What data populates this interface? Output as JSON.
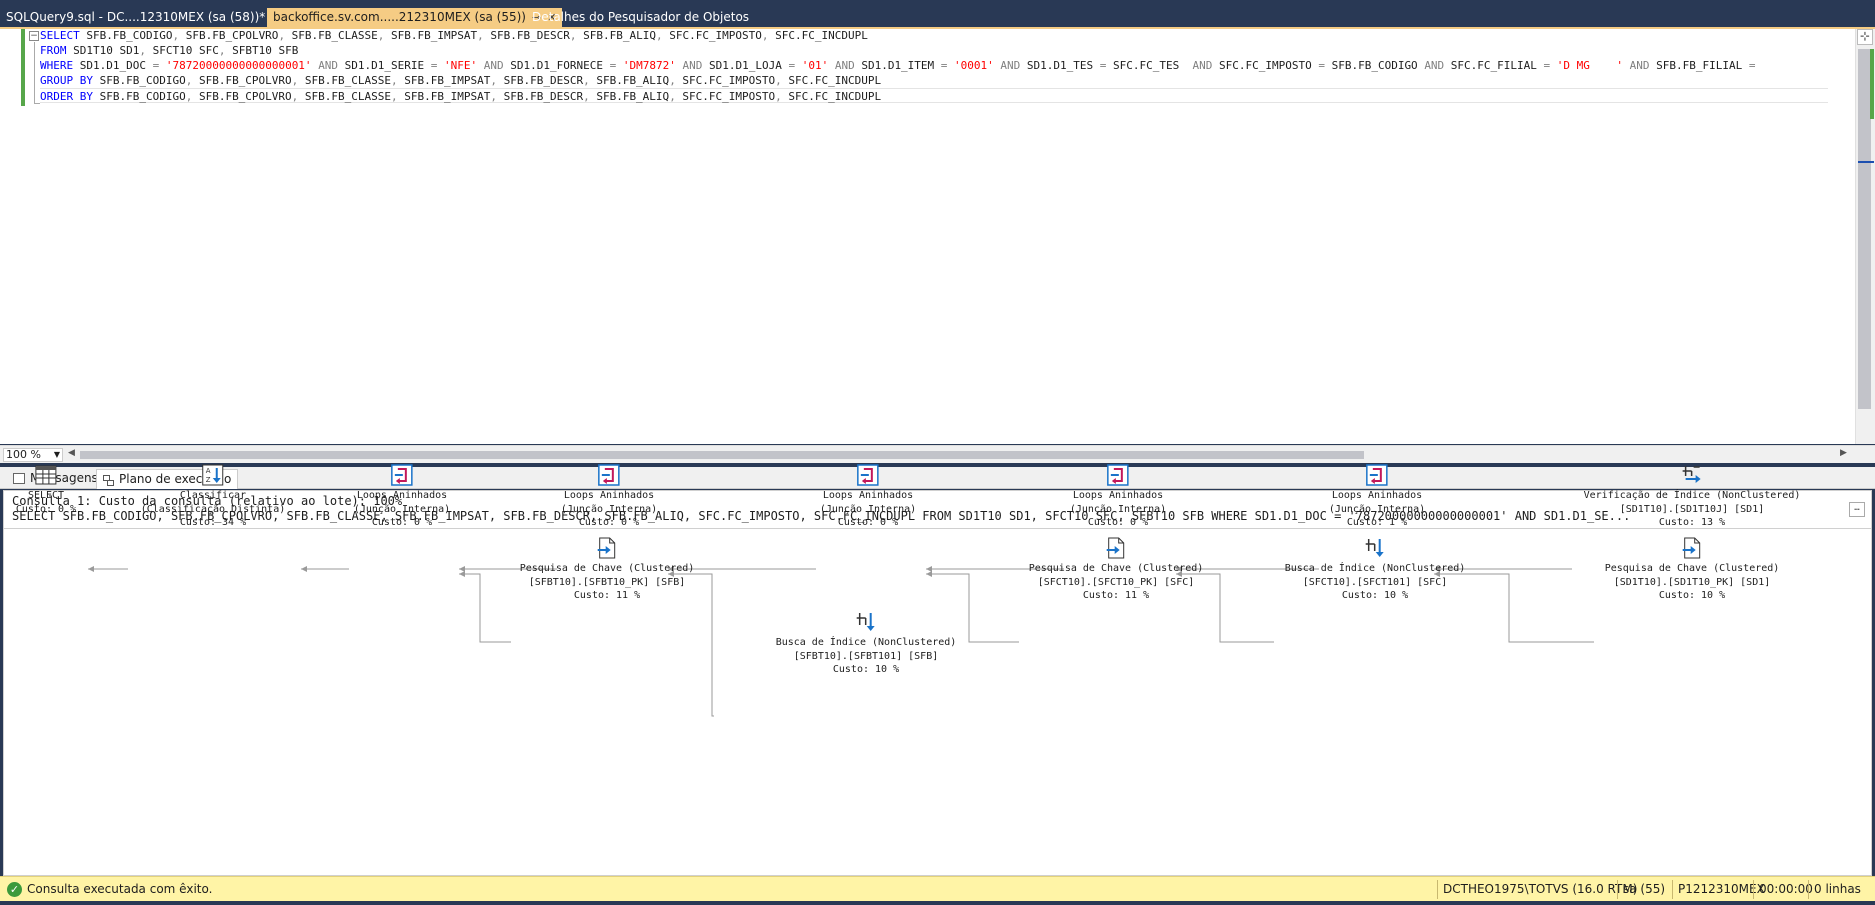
{
  "tabs": [
    {
      "label": "SQLQuery9.sql - DC....12310MEX (sa (58))*",
      "active": false
    },
    {
      "label": "backoffice.sv.com.....212310MEX (sa (55))",
      "active": true,
      "pin_icon": "pin-icon",
      "close_icon": "close-icon"
    },
    {
      "label": "Detalhes do Pesquisador de Objetos",
      "active": false
    }
  ],
  "editor": {
    "zoom": "100 %",
    "lines": [
      [
        [
          "kw",
          "SELECT"
        ],
        [
          "t",
          " SFB.FB_CODIGO"
        ],
        [
          "op",
          ","
        ],
        [
          "t",
          " SFB.FB_CPOLVRO"
        ],
        [
          "op",
          ","
        ],
        [
          "t",
          " SFB.FB_CLASSE"
        ],
        [
          "op",
          ","
        ],
        [
          "t",
          " SFB.FB_IMPSAT"
        ],
        [
          "op",
          ","
        ],
        [
          "t",
          " SFB.FB_DESCR"
        ],
        [
          "op",
          ","
        ],
        [
          "t",
          " SFB.FB_ALIQ"
        ],
        [
          "op",
          ","
        ],
        [
          "t",
          " SFC.FC_IMPOSTO"
        ],
        [
          "op",
          ","
        ],
        [
          "t",
          " SFC.FC_INCDUPL"
        ]
      ],
      [
        [
          "kw",
          "FROM"
        ],
        [
          "t",
          " SD1T10 SD1"
        ],
        [
          "op",
          ","
        ],
        [
          "t",
          " SFCT10 SFC"
        ],
        [
          "op",
          ","
        ],
        [
          "t",
          " SFBT10 SFB"
        ]
      ],
      [
        [
          "kw",
          "WHERE"
        ],
        [
          "t",
          " SD1.D1_DOC "
        ],
        [
          "op",
          "="
        ],
        [
          "t",
          " "
        ],
        [
          "str",
          "'78720000000000000001'"
        ],
        [
          "t",
          " "
        ],
        [
          "op",
          "AND"
        ],
        [
          "t",
          " SD1.D1_SERIE "
        ],
        [
          "op",
          "="
        ],
        [
          "t",
          " "
        ],
        [
          "str",
          "'NFE'"
        ],
        [
          "t",
          " "
        ],
        [
          "op",
          "AND"
        ],
        [
          "t",
          " SD1.D1_FORNECE "
        ],
        [
          "op",
          "="
        ],
        [
          "t",
          " "
        ],
        [
          "str",
          "'DM7872'"
        ],
        [
          "t",
          " "
        ],
        [
          "op",
          "AND"
        ],
        [
          "t",
          " SD1.D1_LOJA "
        ],
        [
          "op",
          "="
        ],
        [
          "t",
          " "
        ],
        [
          "str",
          "'01'"
        ],
        [
          "t",
          " "
        ],
        [
          "op",
          "AND"
        ],
        [
          "t",
          " SD1.D1_ITEM "
        ],
        [
          "op",
          "="
        ],
        [
          "t",
          " "
        ],
        [
          "str",
          "'0001'"
        ],
        [
          "t",
          " "
        ],
        [
          "op",
          "AND"
        ],
        [
          "t",
          " SD1.D1_TES "
        ],
        [
          "op",
          "="
        ],
        [
          "t",
          " SFC.FC_TES  "
        ],
        [
          "op",
          "AND"
        ],
        [
          "t",
          " SFC.FC_IMPOSTO "
        ],
        [
          "op",
          "="
        ],
        [
          "t",
          " SFB.FB_CODIGO "
        ],
        [
          "op",
          "AND"
        ],
        [
          "t",
          " SFC.FC_FILIAL "
        ],
        [
          "op",
          "="
        ],
        [
          "t",
          " "
        ],
        [
          "str",
          "'D MG    '"
        ],
        [
          "t",
          " "
        ],
        [
          "op",
          "AND"
        ],
        [
          "t",
          " SFB.FB_FILIAL "
        ],
        [
          "op",
          "="
        ]
      ],
      [
        [
          "kw",
          "GROUP BY"
        ],
        [
          "t",
          " SFB.FB_CODIGO"
        ],
        [
          "op",
          ","
        ],
        [
          "t",
          " SFB.FB_CPOLVRO"
        ],
        [
          "op",
          ","
        ],
        [
          "t",
          " SFB.FB_CLASSE"
        ],
        [
          "op",
          ","
        ],
        [
          "t",
          " SFB.FB_IMPSAT"
        ],
        [
          "op",
          ","
        ],
        [
          "t",
          " SFB.FB_DESCR"
        ],
        [
          "op",
          ","
        ],
        [
          "t",
          " SFB.FB_ALIQ"
        ],
        [
          "op",
          ","
        ],
        [
          "t",
          " SFC.FC_IMPOSTO"
        ],
        [
          "op",
          ","
        ],
        [
          "t",
          " SFC.FC_INCDUPL"
        ]
      ],
      [
        [
          "kw",
          "ORDER BY"
        ],
        [
          "t",
          " SFB.FB_CODIGO"
        ],
        [
          "op",
          ","
        ],
        [
          "t",
          " SFB.FB_CPOLVRO"
        ],
        [
          "op",
          ","
        ],
        [
          "t",
          " SFB.FB_CLASSE"
        ],
        [
          "op",
          ","
        ],
        [
          "t",
          " SFB.FB_IMPSAT"
        ],
        [
          "op",
          ","
        ],
        [
          "t",
          " SFB.FB_DESCR"
        ],
        [
          "op",
          ","
        ],
        [
          "t",
          " SFB.FB_ALIQ"
        ],
        [
          "op",
          ","
        ],
        [
          "t",
          " SFC.FC_IMPOSTO"
        ],
        [
          "op",
          ","
        ],
        [
          "t",
          " SFC.FC_INCDUPL"
        ]
      ]
    ]
  },
  "results": {
    "tabs": [
      {
        "label": "Mensagens",
        "icon": "messages-icon"
      },
      {
        "label": "Plano de execução",
        "icon": "execution-plan-icon"
      }
    ],
    "plan_header": {
      "query_cost": "Consulta 1: Custo da consulta (relativo ao lote): 100%",
      "query_text": "SELECT SFB.FB_CODIGO, SFB.FB_CPOLVRO, SFB.FB_CLASSE, SFB.FB_IMPSAT, SFB.FB_DESCR, SFB.FB_ALIQ, SFC.FC_IMPOSTO, SFC.FC_INCDUPL FROM SD1T10 SD1, SFCT10 SFC, SFBT10 SFB WHERE SD1.D1_DOC = '78720000000000000001' AND SD1.D1_SE..."
    },
    "plan_nodes": [
      {
        "id": "select",
        "icon": "select-icon",
        "lines": [
          "SELECT",
          "Custo: 0 %"
        ]
      },
      {
        "id": "sort",
        "icon": "sort-icon",
        "lines": [
          "Classificar",
          "(Classificação Distinta)",
          "Custo: 34 %"
        ]
      },
      {
        "id": "loop1",
        "icon": "nested-loops-icon",
        "lines": [
          "Loops Aninhados",
          "(Junção Interna)",
          "Custo: 0 %"
        ]
      },
      {
        "id": "loop2",
        "icon": "nested-loops-icon",
        "lines": [
          "Loops Aninhados",
          "(Junção Interna)",
          "Custo: 0 %"
        ]
      },
      {
        "id": "loop3",
        "icon": "nested-loops-icon",
        "lines": [
          "Loops Aninhados",
          "(Junção Interna)",
          "Custo: 0 %"
        ]
      },
      {
        "id": "loop4",
        "icon": "nested-loops-icon",
        "lines": [
          "Loops Aninhados",
          "(Junção Interna)",
          "Custo: 0 %"
        ]
      },
      {
        "id": "loop5",
        "icon": "nested-loops-icon",
        "lines": [
          "Loops Aninhados",
          "(Junção Interna)",
          "Custo: 1 %"
        ]
      },
      {
        "id": "idxscan",
        "icon": "index-scan-icon",
        "lines": [
          "Verificação de Índice (NonClustered)",
          "[SD1T10].[SD1T10J] [SD1]",
          "Custo: 13 %"
        ]
      },
      {
        "id": "lookup_sfb",
        "icon": "key-lookup-icon",
        "lines": [
          "Pesquisa de Chave (Clustered)",
          "[SFBT10].[SFBT10_PK] [SFB]",
          "Custo: 11 %"
        ]
      },
      {
        "id": "lookup_sfc",
        "icon": "key-lookup-icon",
        "lines": [
          "Pesquisa de Chave (Clustered)",
          "[SFCT10].[SFCT10_PK] [SFC]",
          "Custo: 11 %"
        ]
      },
      {
        "id": "seek_sfc",
        "icon": "index-seek-icon",
        "lines": [
          "Busca de Índice (NonClustered)",
          "[SFCT10].[SFCT101] [SFC]",
          "Custo: 10 %"
        ]
      },
      {
        "id": "lookup_sd1",
        "icon": "key-lookup-icon",
        "lines": [
          "Pesquisa de Chave (Clustered)",
          "[SD1T10].[SD1T10_PK] [SD1]",
          "Custo: 10 %"
        ]
      },
      {
        "id": "seek_sfb",
        "icon": "index-seek-icon",
        "lines": [
          "Busca de Índice (NonClustered)",
          "[SFBT10].[SFBT101] [SFB]",
          "Custo: 10 %"
        ]
      }
    ]
  },
  "statusbar": {
    "message": "Consulta executada com êxito.",
    "server": "DCTHEO1975\\TOTVS (16.0 RTM)",
    "user": "sa (55)",
    "database": "P1212310MEX",
    "elapsed": "00:00:00",
    "rows": "0 linhas"
  },
  "colors": {
    "titlebar": "#293955",
    "active_tab": "#f5cc84",
    "keyword": "#0000ff",
    "string": "#ff0000",
    "operator": "#808080",
    "statusbar": "#fff4a6",
    "success": "#3c9a3c"
  }
}
